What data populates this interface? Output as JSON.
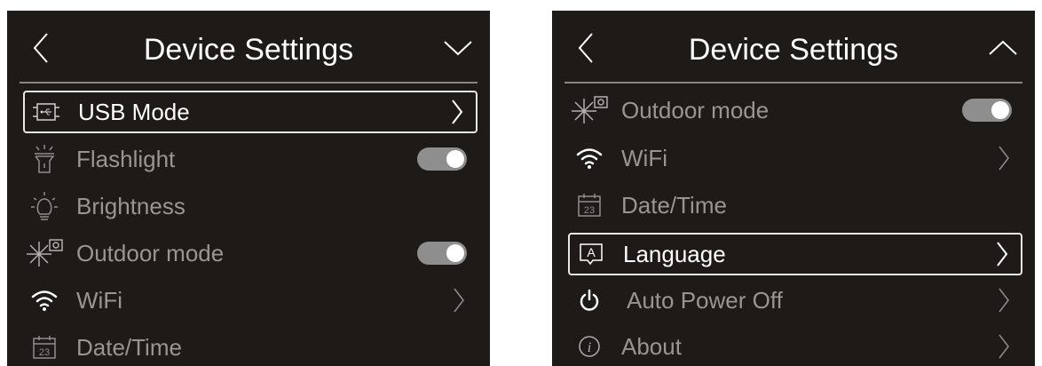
{
  "left_screen": {
    "title": "Device Settings",
    "back_icon": "chevron-left-icon",
    "scroll_icon": "chevron-down-icon",
    "items": [
      {
        "label": "USB Mode",
        "icon": "usb-mode-icon",
        "control": "chevron",
        "selected": true
      },
      {
        "label": "Flashlight",
        "icon": "flashlight-icon",
        "control": "toggle",
        "state": "on"
      },
      {
        "label": "Brightness",
        "icon": "brightness-icon",
        "control": "none"
      },
      {
        "label": "Outdoor mode",
        "icon": "outdoor-mode-icon",
        "control": "toggle",
        "state": "on"
      },
      {
        "label": "WiFi",
        "icon": "wifi-icon",
        "control": "chevron"
      },
      {
        "label": "Date/Time",
        "icon": "calendar-icon",
        "icon_text": "23",
        "control": "none"
      }
    ]
  },
  "right_screen": {
    "title": "Device Settings",
    "back_icon": "chevron-left-icon",
    "scroll_icon": "chevron-up-icon",
    "items": [
      {
        "label": "Outdoor mode",
        "icon": "outdoor-mode-icon",
        "control": "toggle",
        "state": "on"
      },
      {
        "label": "WiFi",
        "icon": "wifi-icon",
        "control": "chevron"
      },
      {
        "label": "Date/Time",
        "icon": "calendar-icon",
        "icon_text": "23",
        "control": "none"
      },
      {
        "label": "Language",
        "icon": "language-icon",
        "icon_text": "A",
        "control": "chevron",
        "selected": true
      },
      {
        "label": "Auto Power Off",
        "icon": "power-icon",
        "control": "chevron"
      },
      {
        "label": "About",
        "icon": "info-icon",
        "icon_text": "i",
        "control": "chevron"
      }
    ]
  },
  "colors": {
    "screen_bg": "#1d1a17",
    "text_dim": "#9a9590",
    "text_selected": "#ffffff",
    "toggle_track": "#8e8e8e"
  }
}
